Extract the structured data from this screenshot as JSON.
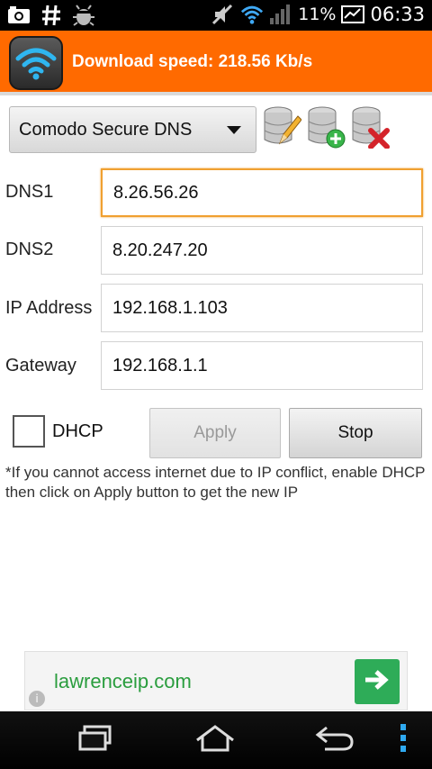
{
  "status_bar": {
    "battery_text": "11%",
    "time": "06:33",
    "icons": [
      "screenshot-icon",
      "hash-icon",
      "android-debug-icon",
      "mute-icon",
      "wifi-icon",
      "signal-icon",
      "battery-icon"
    ]
  },
  "banner": {
    "app_icon": "wifi-icon",
    "title": "Download speed: 218.56 Kb/s",
    "background_color": "#ff6a00"
  },
  "profile": {
    "selected": "Comodo Secure DNS",
    "toolbar": [
      "edit-database-icon",
      "add-database-icon",
      "delete-database-icon"
    ]
  },
  "fields": [
    {
      "label": "DNS1",
      "value": "8.26.56.26",
      "focused": true
    },
    {
      "label": "DNS2",
      "value": "8.20.247.20",
      "focused": false
    },
    {
      "label": "IP Address",
      "value": "192.168.1.103",
      "focused": false
    },
    {
      "label": "Gateway",
      "value": "192.168.1.1",
      "focused": false
    }
  ],
  "dhcp": {
    "label": "DHCP",
    "checked": false
  },
  "buttons": {
    "apply": "Apply",
    "stop": "Stop"
  },
  "hint": "*If you cannot access internet due to IP conflict, enable DHCP then click on Apply button to get the new IP",
  "ad": {
    "text": "lawrenceip.com",
    "info": "i",
    "accent_color": "#2eac58"
  },
  "nav": [
    "recent-apps-icon",
    "home-icon",
    "back-icon",
    "overflow-menu-icon"
  ]
}
